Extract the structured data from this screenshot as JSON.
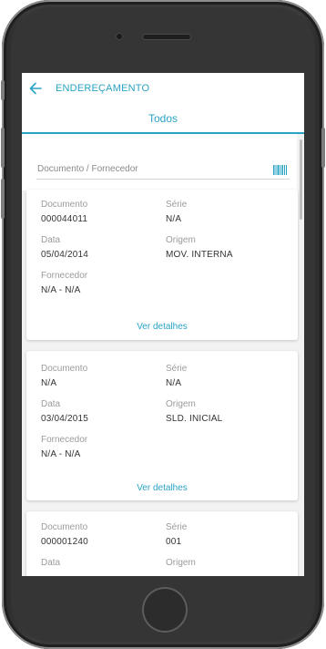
{
  "header": {
    "title": "ENDEREÇAMENTO",
    "back_icon": "arrow-left-icon"
  },
  "tabs": [
    {
      "label": "Todos",
      "active": true
    }
  ],
  "search": {
    "placeholder": "Documento / Fornecedor",
    "value": "",
    "scan_icon": "barcode-icon"
  },
  "labels": {
    "documento": "Documento",
    "serie": "Série",
    "data": "Data",
    "origem": "Origem",
    "fornecedor": "Fornecedor"
  },
  "cards": [
    {
      "documento": "000044011",
      "serie": "N/A",
      "data": "05/04/2014",
      "origem": "MOV. INTERNA",
      "fornecedor": "N/A - N/A",
      "link": "Ver detalhes"
    },
    {
      "documento": "N/A",
      "serie": "N/A",
      "data": "03/04/2015",
      "origem": "SLD. INICIAL",
      "fornecedor": "N/A - N/A",
      "link": "Ver detalhes"
    },
    {
      "documento": "000001240",
      "serie": "001",
      "data": "",
      "origem": "",
      "fornecedor": "",
      "link": ""
    }
  ],
  "colors": {
    "accent": "#29a3c4",
    "label": "#9b9b9b",
    "value": "#333333",
    "background": "#f2f2f2"
  }
}
